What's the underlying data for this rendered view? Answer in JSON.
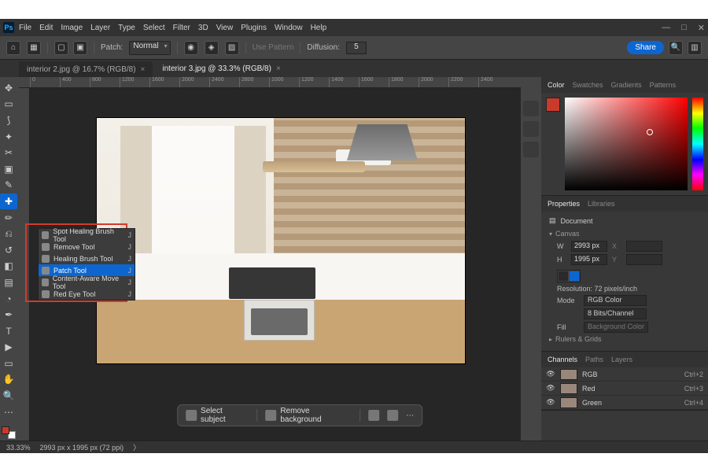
{
  "menu": {
    "items": [
      "File",
      "Edit",
      "Image",
      "Layer",
      "Type",
      "Select",
      "Filter",
      "3D",
      "View",
      "Plugins",
      "Window",
      "Help"
    ]
  },
  "optionsbar": {
    "patch_label": "Patch:",
    "patch_value": "Normal",
    "use_pattern": "Use Pattern",
    "diffusion_label": "Diffusion:",
    "diffusion_value": "5",
    "share": "Share"
  },
  "doc_tabs": [
    {
      "title": "interior 2.jpg @ 16.7% (RGB/8)",
      "active": false
    },
    {
      "title": "interior 3.jpg @ 33.3% (RGB/8)",
      "active": true
    }
  ],
  "ruler_ticks": [
    "0",
    "400",
    "800",
    "1200",
    "1600",
    "2000",
    "2400",
    "2800",
    "1000",
    "1200",
    "1400",
    "1600",
    "1800",
    "2000",
    "2200",
    "2400"
  ],
  "tool_flyout": {
    "items": [
      {
        "label": "Spot Healing Brush Tool",
        "key": "J",
        "selected": false
      },
      {
        "label": "Remove Tool",
        "key": "J",
        "selected": false
      },
      {
        "label": "Healing Brush Tool",
        "key": "J",
        "selected": false
      },
      {
        "label": "Patch Tool",
        "key": "J",
        "selected": true
      },
      {
        "label": "Content-Aware Move Tool",
        "key": "J",
        "selected": false
      },
      {
        "label": "Red Eye Tool",
        "key": "J",
        "selected": false
      }
    ]
  },
  "contextbar": {
    "select_subject": "Select subject",
    "remove_background": "Remove background"
  },
  "right_panels": {
    "color_tabs": [
      "Color",
      "Swatches",
      "Gradients",
      "Patterns"
    ],
    "props_tabs": [
      "Properties",
      "Libraries"
    ],
    "document_label": "Document",
    "canvas_label": "Canvas",
    "width_label": "W",
    "width_value": "2993 px",
    "x_label": "X",
    "x_value": "",
    "height_label": "H",
    "height_value": "1995 px",
    "y_label": "Y",
    "y_value": "",
    "resolution_line": "Resolution: 72 pixels/inch",
    "mode_label": "Mode",
    "mode_value": "RGB Color",
    "depth_value": "8 Bits/Channel",
    "fill_label": "Fill",
    "fill_value": "Background Color",
    "rulers_grids": "Rulers & Grids",
    "chan_tabs": [
      "Channels",
      "Paths",
      "Layers"
    ],
    "channels": [
      {
        "name": "RGB",
        "shortcut": "Ctrl+2"
      },
      {
        "name": "Red",
        "shortcut": "Ctrl+3"
      },
      {
        "name": "Green",
        "shortcut": "Ctrl+4"
      }
    ]
  },
  "statusbar": {
    "zoom": "33.33%",
    "dims": "2993 px x 1995 px (72 ppi)"
  }
}
